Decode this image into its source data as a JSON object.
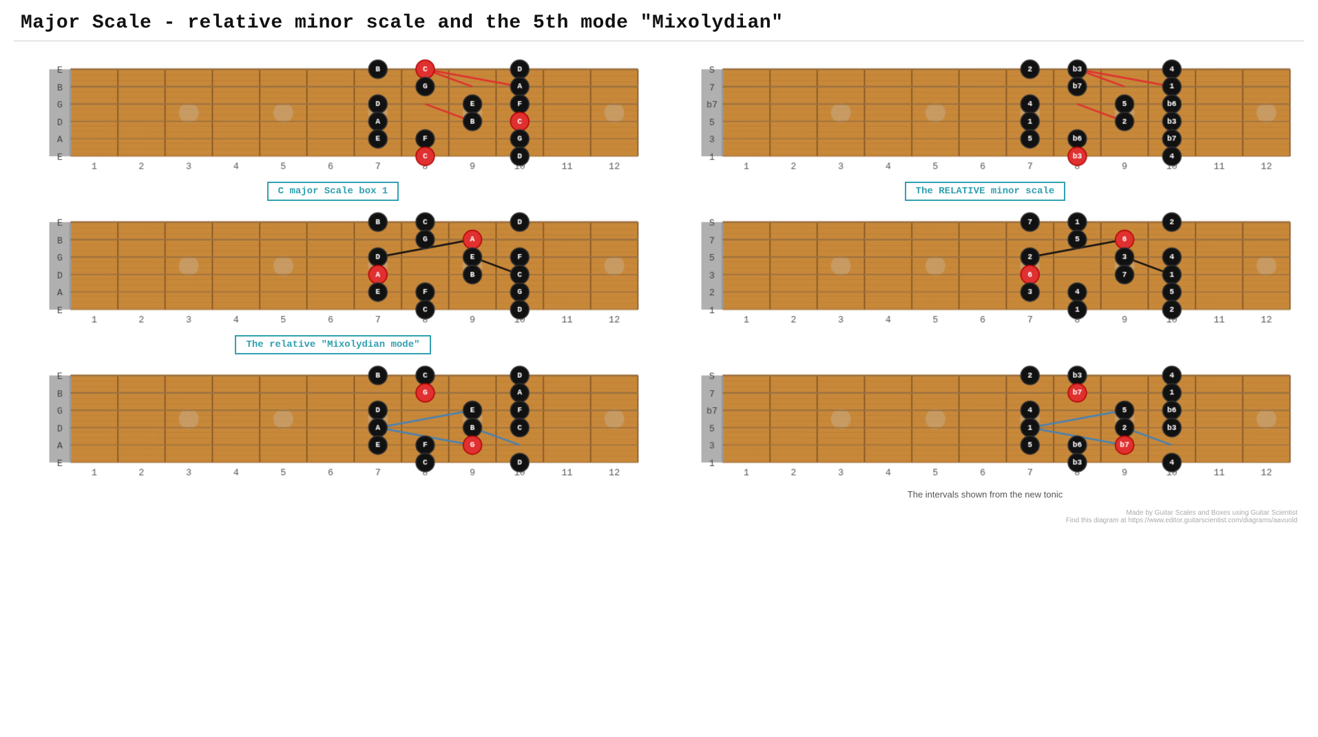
{
  "page": {
    "title": "Major Scale - relative minor scale and the 5th mode \"Mixolydian\"",
    "watermark_line1": "Made by Guitar Scales and Boxes using Guitar Scientist",
    "watermark_line2": "Find this diagram at https://www.editor.guitarscientist.com/diagrams/aavuold"
  },
  "diagrams": [
    {
      "id": "top-left",
      "label": "C major Scale box 1",
      "position": "top-left",
      "note_type": "letter",
      "line_color": "red"
    },
    {
      "id": "top-right",
      "label": "The RELATIVE minor scale",
      "position": "top-right",
      "note_type": "interval",
      "line_color": "red"
    },
    {
      "id": "mid-left",
      "label": "The relative \"Mixolydian mode\"",
      "position": "mid-left",
      "note_type": "letter",
      "line_color": "black"
    },
    {
      "id": "mid-right",
      "label": null,
      "position": "mid-right",
      "note_type": "interval",
      "line_color": "black"
    },
    {
      "id": "bot-left",
      "label": null,
      "position": "bot-left",
      "note_type": "letter",
      "line_color": "steelblue"
    },
    {
      "id": "bot-right",
      "label": null,
      "position": "bot-right",
      "note_type": "interval",
      "line_color": "steelblue"
    }
  ],
  "footer": {
    "intervals_note": "The intervals shown from the new tonic"
  }
}
